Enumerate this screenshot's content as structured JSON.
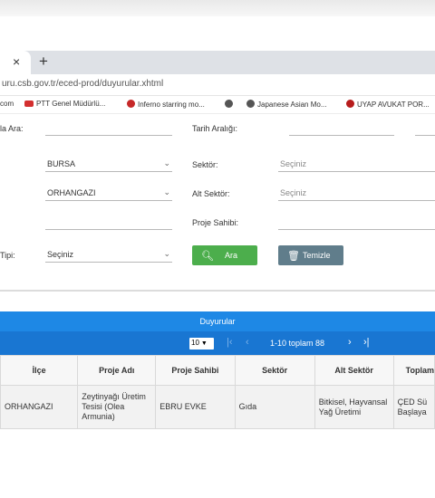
{
  "browser": {
    "tab_close": "×",
    "new_tab": "+",
    "url": "uru.csb.gov.tr/eced-prod/duyurular.xhtml",
    "bookmarks": [
      {
        "label": "com",
        "icon": "none"
      },
      {
        "label": "PTT Genel Müdürlü...",
        "icon": "ptt-icon"
      },
      {
        "label": "Inferno starring mo...",
        "icon": "chrome-icon"
      },
      {
        "label": "",
        "icon": "globe-icon"
      },
      {
        "label": "Japanese Asian Mo...",
        "icon": "globe-icon"
      },
      {
        "label": "UYAP AVUKAT POR...",
        "icon": "uyap-icon"
      }
    ]
  },
  "form": {
    "kelime_label": "la Ara:",
    "tarih_label": "Tarih Aralığı:",
    "il_value": "BURSA",
    "ilce_value": "ORHANGAZI",
    "sektor_label": "Sektör:",
    "sektor_placeholder": "Seçiniz",
    "alt_sektor_label": "Alt Sektör:",
    "alt_sektor_placeholder": "Seçiniz",
    "proje_sahibi_label": "Proje Sahibi:",
    "tipi_label": "Tipi:",
    "tipi_value": "Seçiniz",
    "ara_label": "Ara",
    "temizle_label": "Temizle"
  },
  "panel": {
    "title": "Duyurular",
    "page_size": "10",
    "page_info": "1-10 toplam 88"
  },
  "table": {
    "headers": [
      "İlçe",
      "Proje Adı",
      "Proje Sahibi",
      "Sektör",
      "Alt Sektör",
      "Toplam"
    ],
    "rows": [
      {
        "ilce": "ORHANGAZI",
        "proje_adi": "Zeytinyağı Üretim Tesisi (Olea Armunia)",
        "proje_sahibi": "EBRU EVKE",
        "sektor": "Gıda",
        "alt_sektor": "Bitkisel, Hayvansal Yağ Üretimi",
        "durum": "ÇED Sü Başlaya"
      }
    ]
  },
  "colors": {
    "panel_header": "#1e88e5",
    "pager": "#1976d2",
    "ara_button": "#4cae4c",
    "temizle_button": "#607d8b"
  }
}
